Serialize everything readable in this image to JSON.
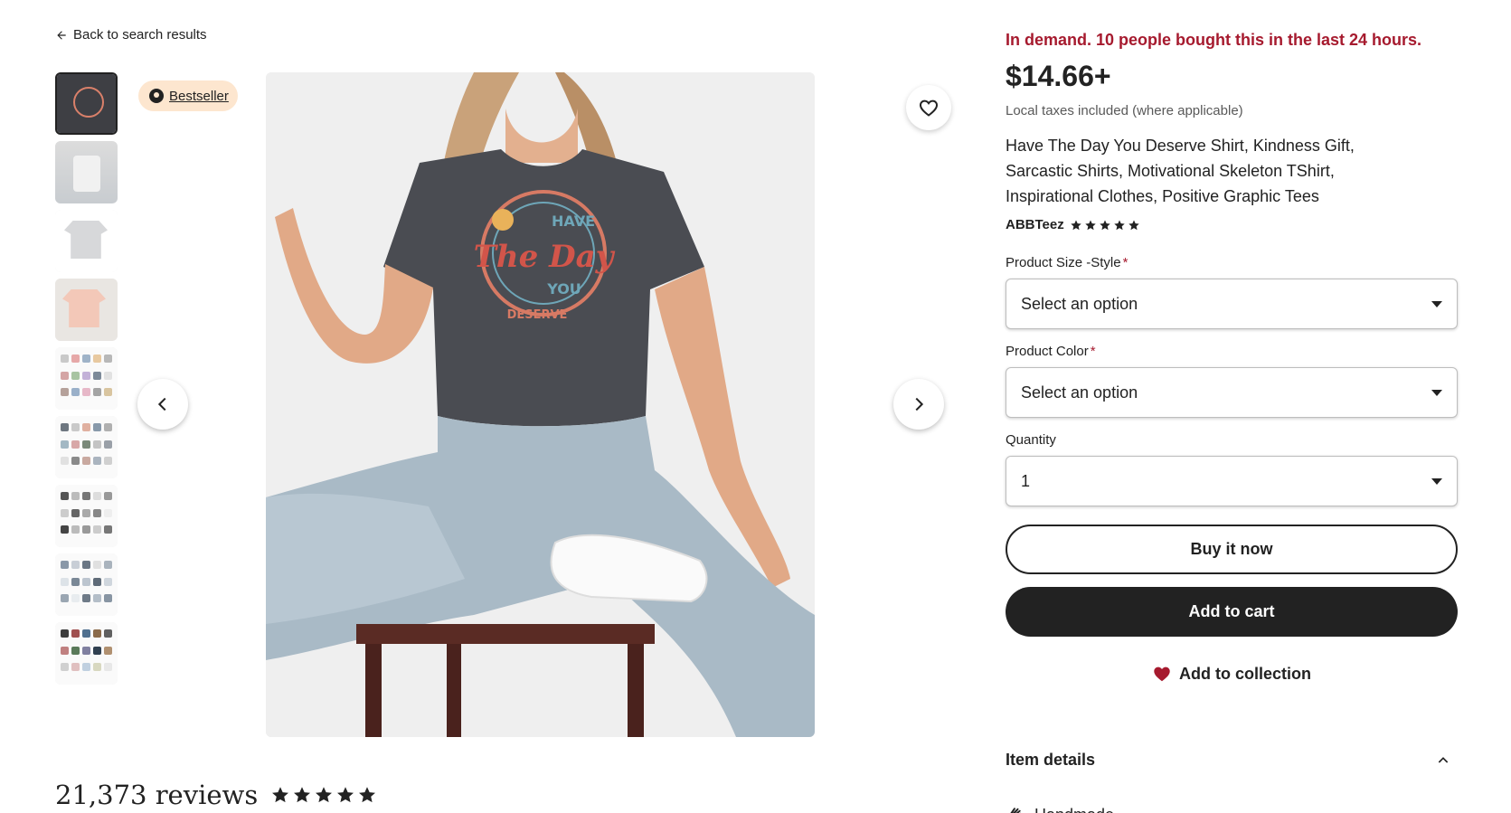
{
  "nav": {
    "back_label": "Back to search results"
  },
  "badge": {
    "label": "Bestseller"
  },
  "gallery": {
    "thumbnail_count": 9,
    "active_index": 0,
    "image_alt": "Have The Day You Deserve skeleton graphic tee"
  },
  "reviews": {
    "count_label": "21,373 reviews",
    "rating": 5
  },
  "product": {
    "demand_text": "In demand. 10 people bought this in the last 24 hours.",
    "price": "$14.66+",
    "tax_note": "Local taxes included (where applicable)",
    "title": "Have The Day You Deserve Shirt, Kindness Gift, Sarcastic Shirts, Motivational Skeleton TShirt, Inspirational Clothes, Positive Graphic Tees",
    "shop_name": "ABBTeez",
    "shop_rating": 5
  },
  "options": {
    "size": {
      "label": "Product Size -Style",
      "required_mark": "*",
      "value": "Select an option"
    },
    "color": {
      "label": "Product Color",
      "required_mark": "*",
      "value": "Select an option"
    },
    "quantity": {
      "label": "Quantity",
      "value": "1"
    }
  },
  "actions": {
    "buy_now": "Buy it now",
    "add_to_cart": "Add to cart",
    "add_to_collection": "Add to collection"
  },
  "details": {
    "heading": "Item details",
    "handmade": "Handmade"
  },
  "colors": {
    "demand_red": "#a61a2e",
    "badge_bg": "#fde6cf",
    "cart_bg": "#222222",
    "heart_red": "#a61a2e"
  }
}
